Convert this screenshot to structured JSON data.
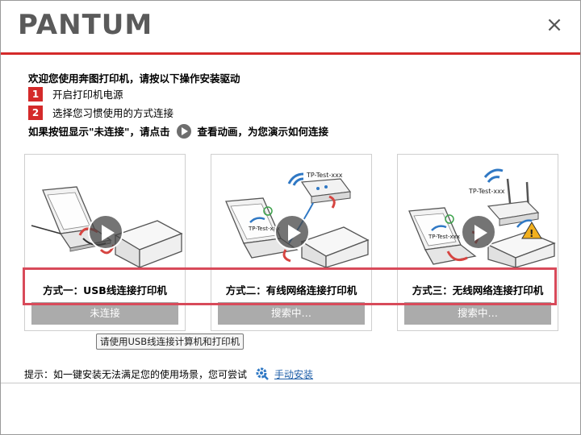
{
  "header": {
    "logo": "PANTUM",
    "close_glyph": "×"
  },
  "intro": "欢迎您使用奔图打印机，请按以下操作安装驱动",
  "steps": [
    {
      "num": "1",
      "text": "开启打印机电源"
    },
    {
      "num": "2",
      "text": "选择您习惯使用的方式连接"
    }
  ],
  "hint": {
    "before": "如果按钮显示\"未连接\"，请点击",
    "after": "查看动画，为您演示如何连接"
  },
  "cards": [
    {
      "method": "方式一：USB线连接打印机",
      "status": "未连接"
    },
    {
      "method": "方式二：有线网络连接打印机",
      "status": "搜索中…",
      "router_label": "TP-Test-xxx",
      "screen_label": "TP-Test-xxx"
    },
    {
      "method": "方式三：无线网络连接打印机",
      "status": "搜索中…",
      "router_label": "TP-Test-xxx",
      "screen_label": "TP-Test-xxx"
    }
  ],
  "tooltip": "请使用USB线连接计算机和打印机",
  "footer": {
    "tip": "提示：如一键安装无法满足您的使用场景，您可尝试",
    "link": "手动安装"
  },
  "colors": {
    "accent_red": "#d42a2a",
    "link_blue": "#1f5fa8",
    "button_gray": "#ababab"
  }
}
